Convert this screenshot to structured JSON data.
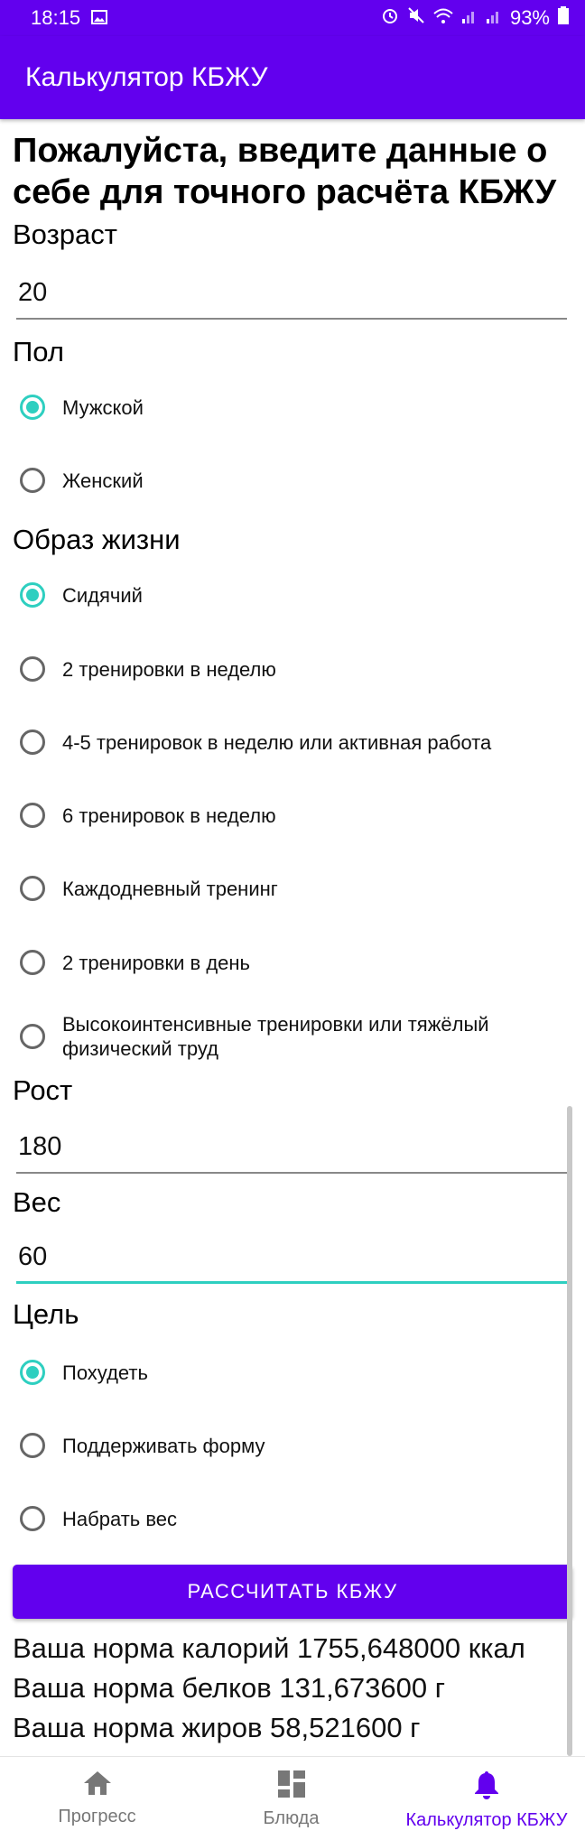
{
  "status_bar": {
    "time": "18:15",
    "battery": "93%"
  },
  "app_bar": {
    "title": "Калькулятор КБЖУ"
  },
  "form": {
    "heading": "Пожалуйста, введите данные о себе для точного расчёта КБЖУ",
    "age": {
      "label": "Возраст",
      "value": "20"
    },
    "gender": {
      "label": "Пол",
      "options": [
        {
          "label": "Мужской",
          "checked": true
        },
        {
          "label": "Женский",
          "checked": false
        }
      ]
    },
    "lifestyle": {
      "label": "Образ жизни",
      "options": [
        {
          "label": "Сидячий",
          "checked": true
        },
        {
          "label": "2 тренировки в неделю",
          "checked": false
        },
        {
          "label": "4-5 тренировок в неделю или активная работа",
          "checked": false
        },
        {
          "label": "6 тренировок в неделю",
          "checked": false
        },
        {
          "label": "Каждодневный тренинг",
          "checked": false
        },
        {
          "label": "2 тренировки в день",
          "checked": false
        },
        {
          "label": "Высокоинтенсивные тренировки или тяжёлый физический труд",
          "checked": false
        }
      ]
    },
    "height": {
      "label": "Рост",
      "value": "180"
    },
    "weight": {
      "label": "Вес",
      "value": "60"
    },
    "goal": {
      "label": "Цель",
      "options": [
        {
          "label": "Похудеть",
          "checked": true
        },
        {
          "label": "Поддерживать форму",
          "checked": false
        },
        {
          "label": "Набрать вес",
          "checked": false
        }
      ]
    },
    "calculate_button": "РАССЧИТАТЬ КБЖУ"
  },
  "results": {
    "calories": "Ваша норма калорий 1755,648000 ккал",
    "protein": "Ваша норма белков 131,673600 г",
    "fat": "Ваша норма жиров 58,521600 г"
  },
  "bottom_nav": {
    "items": [
      {
        "label": "Прогресс",
        "icon": "home-icon",
        "active": false
      },
      {
        "label": "Блюда",
        "icon": "dashboard-icon",
        "active": false
      },
      {
        "label": "Калькулятор КБЖУ",
        "icon": "bell-icon",
        "active": true
      }
    ]
  },
  "colors": {
    "primary": "#6200ee",
    "accent": "#2ecfc0"
  }
}
